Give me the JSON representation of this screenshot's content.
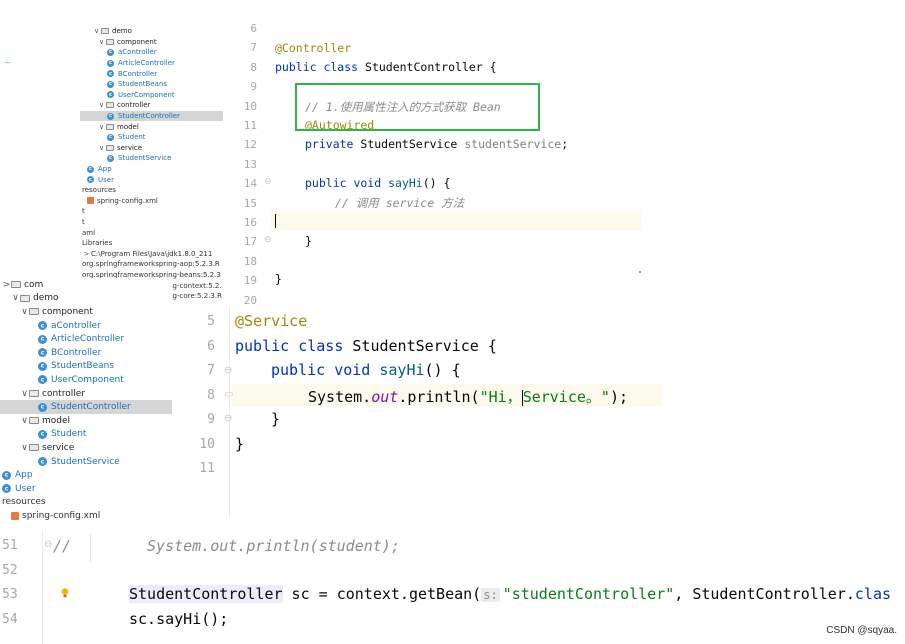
{
  "tree1": {
    "rows": [
      {
        "label": "demo",
        "kind": "pkg",
        "arrow": "∨"
      },
      {
        "label": "component",
        "kind": "pkg",
        "arrow": "∨"
      },
      {
        "label": "aController",
        "kind": "cls"
      },
      {
        "label": "ArticleController",
        "kind": "cls"
      },
      {
        "label": "BController",
        "kind": "cls"
      },
      {
        "label": "StudentBeans",
        "kind": "cls"
      },
      {
        "label": "UserComponent",
        "kind": "cls"
      },
      {
        "label": "controller",
        "kind": "pkg",
        "arrow": "∨"
      },
      {
        "label": "StudentController",
        "kind": "cls",
        "selected": true
      },
      {
        "label": "model",
        "kind": "pkg",
        "arrow": "∨"
      },
      {
        "label": "Student",
        "kind": "cls"
      },
      {
        "label": "service",
        "kind": "pkg",
        "arrow": "∨"
      },
      {
        "label": "StudentService",
        "kind": "cls"
      },
      {
        "label": "App",
        "kind": "app"
      },
      {
        "label": "User",
        "kind": "cls"
      },
      {
        "label": "resources",
        "kind": "text"
      },
      {
        "label": "spring-config.xml",
        "kind": "xml"
      },
      {
        "label": "t",
        "kind": "text"
      },
      {
        "label": "t",
        "kind": "text"
      },
      {
        "label": "aml",
        "kind": "text"
      },
      {
        "label": "Libraries",
        "kind": "text"
      },
      {
        "label": "C:\\Program Files\\Java\\jdk1.8.0_211",
        "kind": "lib",
        "arrow": ">"
      },
      {
        "label": "org.springframeworkspring-aop:5.2.3.R",
        "kind": "lib"
      },
      {
        "label": "org.springframeworkspring-beans:5.2.3",
        "kind": "lib"
      },
      {
        "label": "org.springframeworkspring-context:5.2.",
        "kind": "lib"
      },
      {
        "label": "org.springframeworkspring-core:5.2.3.R",
        "kind": "lib"
      }
    ]
  },
  "tree2": {
    "rows": [
      {
        "label": "com",
        "kind": "pkg",
        "arrow": ">"
      },
      {
        "label": "demo",
        "kind": "pkg",
        "arrow": "∨"
      },
      {
        "label": "component",
        "kind": "pkg",
        "arrow": "∨"
      },
      {
        "label": "aController",
        "kind": "cls"
      },
      {
        "label": "ArticleController",
        "kind": "cls"
      },
      {
        "label": "BController",
        "kind": "cls"
      },
      {
        "label": "StudentBeans",
        "kind": "cls"
      },
      {
        "label": "UserComponent",
        "kind": "cls"
      },
      {
        "label": "controller",
        "kind": "pkg",
        "arrow": "∨"
      },
      {
        "label": "StudentController",
        "kind": "cls",
        "selected": true
      },
      {
        "label": "model",
        "kind": "pkg",
        "arrow": "∨"
      },
      {
        "label": "Student",
        "kind": "cls"
      },
      {
        "label": "service",
        "kind": "pkg",
        "arrow": "∨"
      },
      {
        "label": "StudentService",
        "kind": "cls"
      },
      {
        "label": "App",
        "kind": "app"
      },
      {
        "label": "User",
        "kind": "cls"
      },
      {
        "label": "resources",
        "kind": "text"
      },
      {
        "label": "spring-config.xml",
        "kind": "xml"
      }
    ]
  },
  "editor1": {
    "line_numbers": [
      "6",
      "7",
      "8",
      "9",
      "10",
      "11",
      "12",
      "13",
      "14",
      "15",
      "16",
      "17",
      "18",
      "19",
      "20"
    ],
    "l7_ann": "@Controller",
    "l8_kw": "public class",
    "l8_rest": " StudentController {",
    "l10_comment": "// 1.使用属性注入的方式获取 Bean",
    "l11_ann": "@Autowired",
    "l12_kw": "private",
    "l12_type": " StudentService ",
    "l12_field": "studentService",
    "l12_end": ";",
    "l14_kw": "public void",
    "l14_fn": " sayHi",
    "l14_end": "() {",
    "l15_comment": "// 调用 service 方法",
    "l17": "}",
    "l19": "}"
  },
  "editor2": {
    "line_numbers": [
      "5",
      "6",
      "7",
      "8",
      "9",
      "10",
      "11"
    ],
    "l5_ann": "@Service",
    "l6_kw": "public class",
    "l6_rest": " StudentService {",
    "l7_kw": "public void",
    "l7_fn": " sayHi",
    "l7_end": "() {",
    "l8_sys": "System.",
    "l8_out": "out",
    "l8_call": ".println(",
    "l8_str_a": "\"Hi，",
    "l8_str_b": "Service。\"",
    "l8_end": ");",
    "l9": "}",
    "l10": "}"
  },
  "editor3": {
    "line_numbers": [
      "51",
      "52",
      "53",
      "54"
    ],
    "l51_slash": "//",
    "l51_comment": "System.out.println(student);",
    "l53_type": "StudentController",
    "l53_mid": " sc = context.getBean(",
    "l53_hint": "s:",
    "l53_str": "\"studentController\"",
    "l53_tail_a": ", StudentController.",
    "l53_tail_b": "clas",
    "l54": "sc.sayHi();"
  },
  "colors": {
    "highlight_box": "#2fb34a",
    "selection": "#d5d5d5",
    "keyword": "#0033b3",
    "annotation": "#9e880d",
    "string": "#067d17",
    "comment": "#8c8c8c"
  },
  "watermark": "CSDN @sqyaa."
}
